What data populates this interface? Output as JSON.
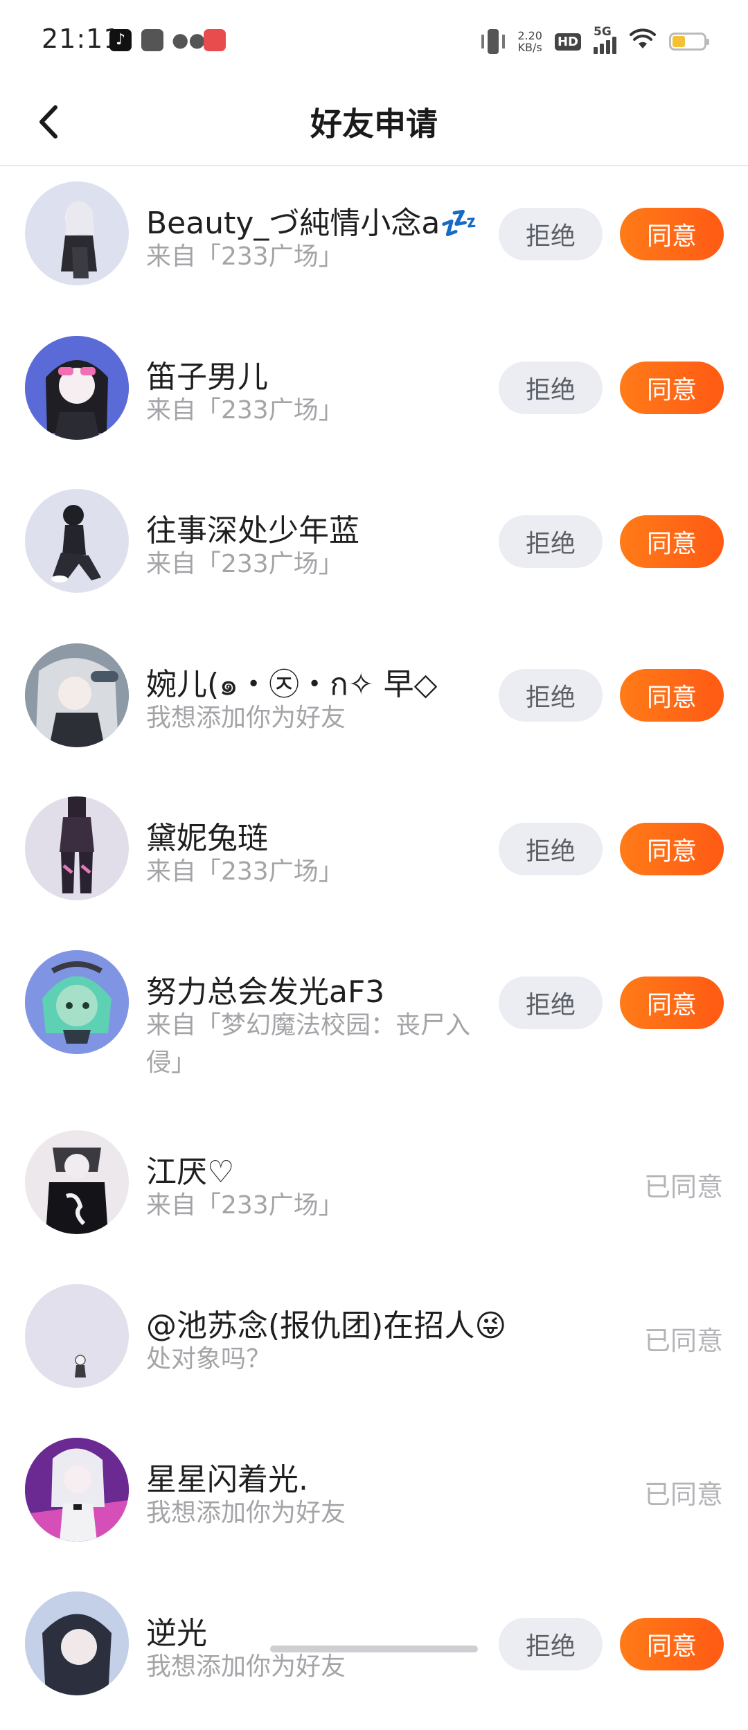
{
  "status_bar": {
    "time": "21:11",
    "net_speed_value": "2.20",
    "net_speed_unit": "KB/s",
    "hd_label": "HD",
    "network_label": "5G",
    "battery_level": 0.4,
    "apps": [
      "tiktok-icon",
      "app-square-icon",
      "wechat-icon",
      "red-app-icon"
    ]
  },
  "header": {
    "title": "好友申请",
    "back_icon": "chevron-left-icon"
  },
  "buttons": {
    "reject": "拒绝",
    "accept": "同意"
  },
  "colors": {
    "accent": "#ff6a14",
    "reject_bg": "#ebedf3",
    "secondary_text": "#a4a4a8"
  },
  "requests": [
    {
      "name": "Beauty_づ純情小念a💤",
      "sub": "来自「233广场」",
      "state": "pending"
    },
    {
      "name": "笛子男儿",
      "sub": "来自「233广场」",
      "state": "pending"
    },
    {
      "name": "往事深处少年蓝",
      "sub": "来自「233广场」",
      "state": "pending"
    },
    {
      "name": "婉儿(๑・㉨・ก✧ 早◇",
      "sub": "我想添加你为好友",
      "state": "pending"
    },
    {
      "name": "黛妮兔琏",
      "sub": "来自「233广场」",
      "state": "pending"
    },
    {
      "name": "努力总会发光aF3",
      "sub": "来自「梦幻魔法校园：丧尸入侵」",
      "state": "pending"
    },
    {
      "name": "江厌♡",
      "sub": "来自「233广场」",
      "state": "accepted",
      "status_label": "已同意"
    },
    {
      "name": "@池苏念(报仇团)在招人😜",
      "sub": "处对象吗？",
      "state": "accepted",
      "status_label": "已同意"
    },
    {
      "name": "星星闪着光.",
      "sub": "我想添加你为好友",
      "state": "accepted",
      "status_label": "已同意"
    },
    {
      "name": "逆光",
      "sub": "我想添加你为好友",
      "state": "pending"
    }
  ]
}
